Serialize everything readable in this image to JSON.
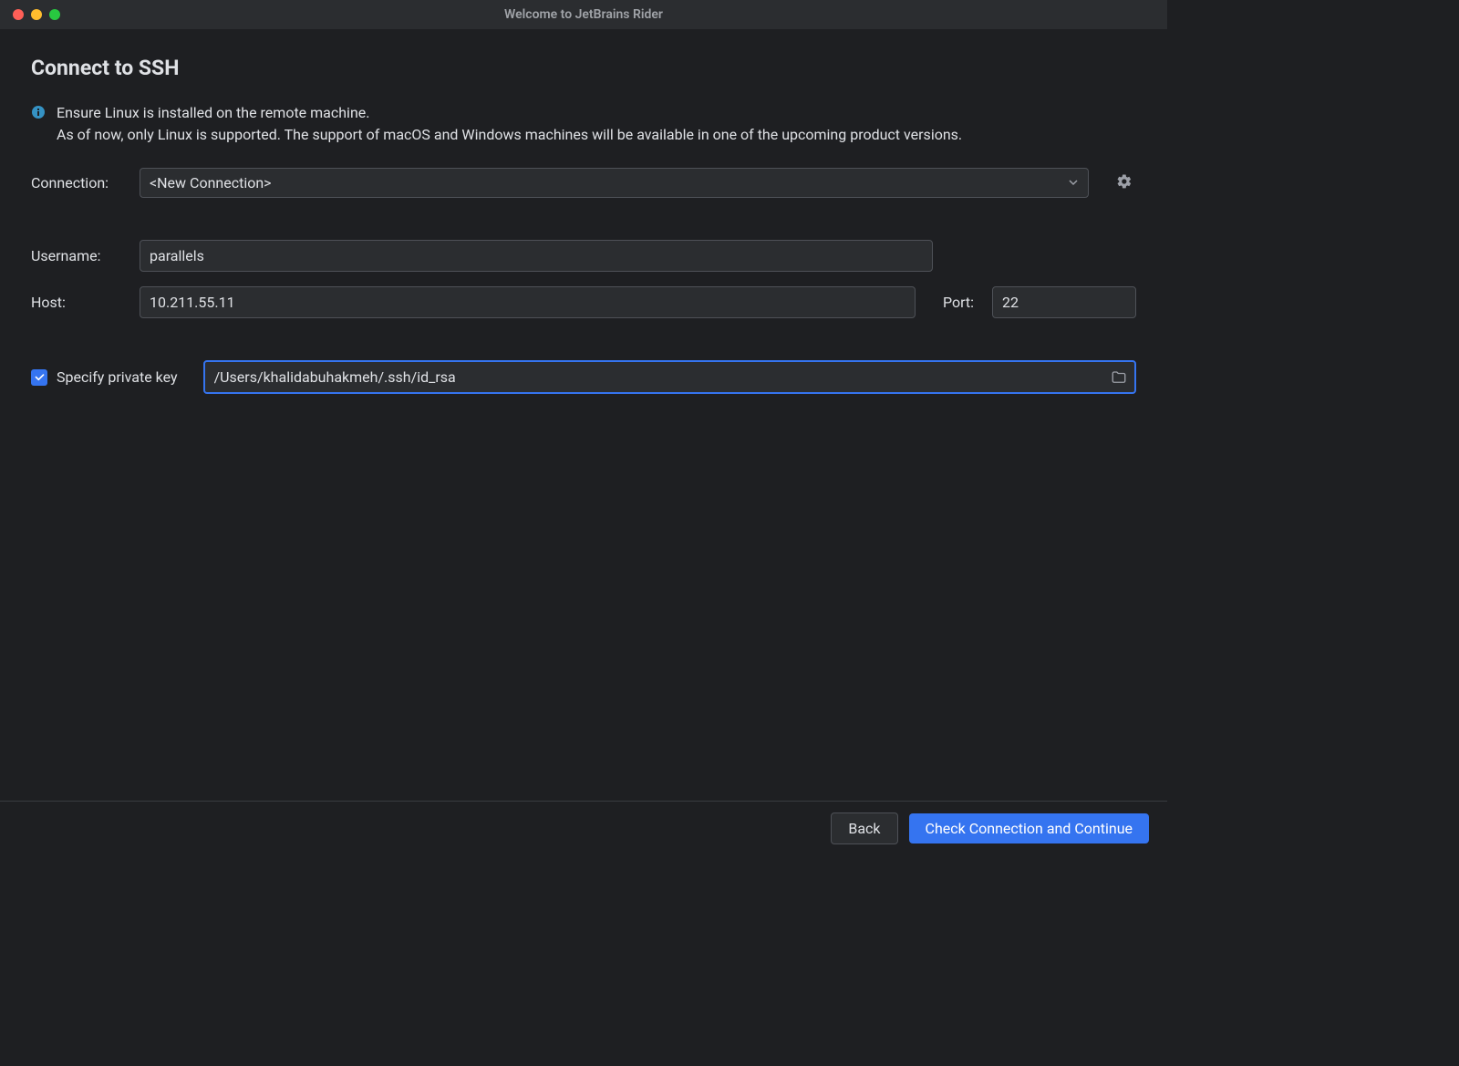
{
  "window": {
    "title": "Welcome to JetBrains Rider"
  },
  "page": {
    "title": "Connect to SSH",
    "info_line1": "Ensure Linux is installed on the remote machine.",
    "info_line2": "As of now, only Linux is supported. The support of macOS and Windows machines will be available in one of the upcoming product versions."
  },
  "form": {
    "connection_label": "Connection:",
    "connection_value": "<New Connection>",
    "username_label": "Username:",
    "username_value": "parallels",
    "host_label": "Host:",
    "host_value": "10.211.55.11",
    "port_label": "Port:",
    "port_value": "22",
    "specify_pk_label": "Specify private key",
    "specify_pk_checked": true,
    "pk_path": "/Users/khalidabuhakmeh/.ssh/id_rsa"
  },
  "footer": {
    "back_label": "Back",
    "continue_label": "Check Connection and Continue"
  },
  "colors": {
    "accent": "#3574f0",
    "bg": "#1e1f22",
    "panel": "#2b2d30"
  }
}
